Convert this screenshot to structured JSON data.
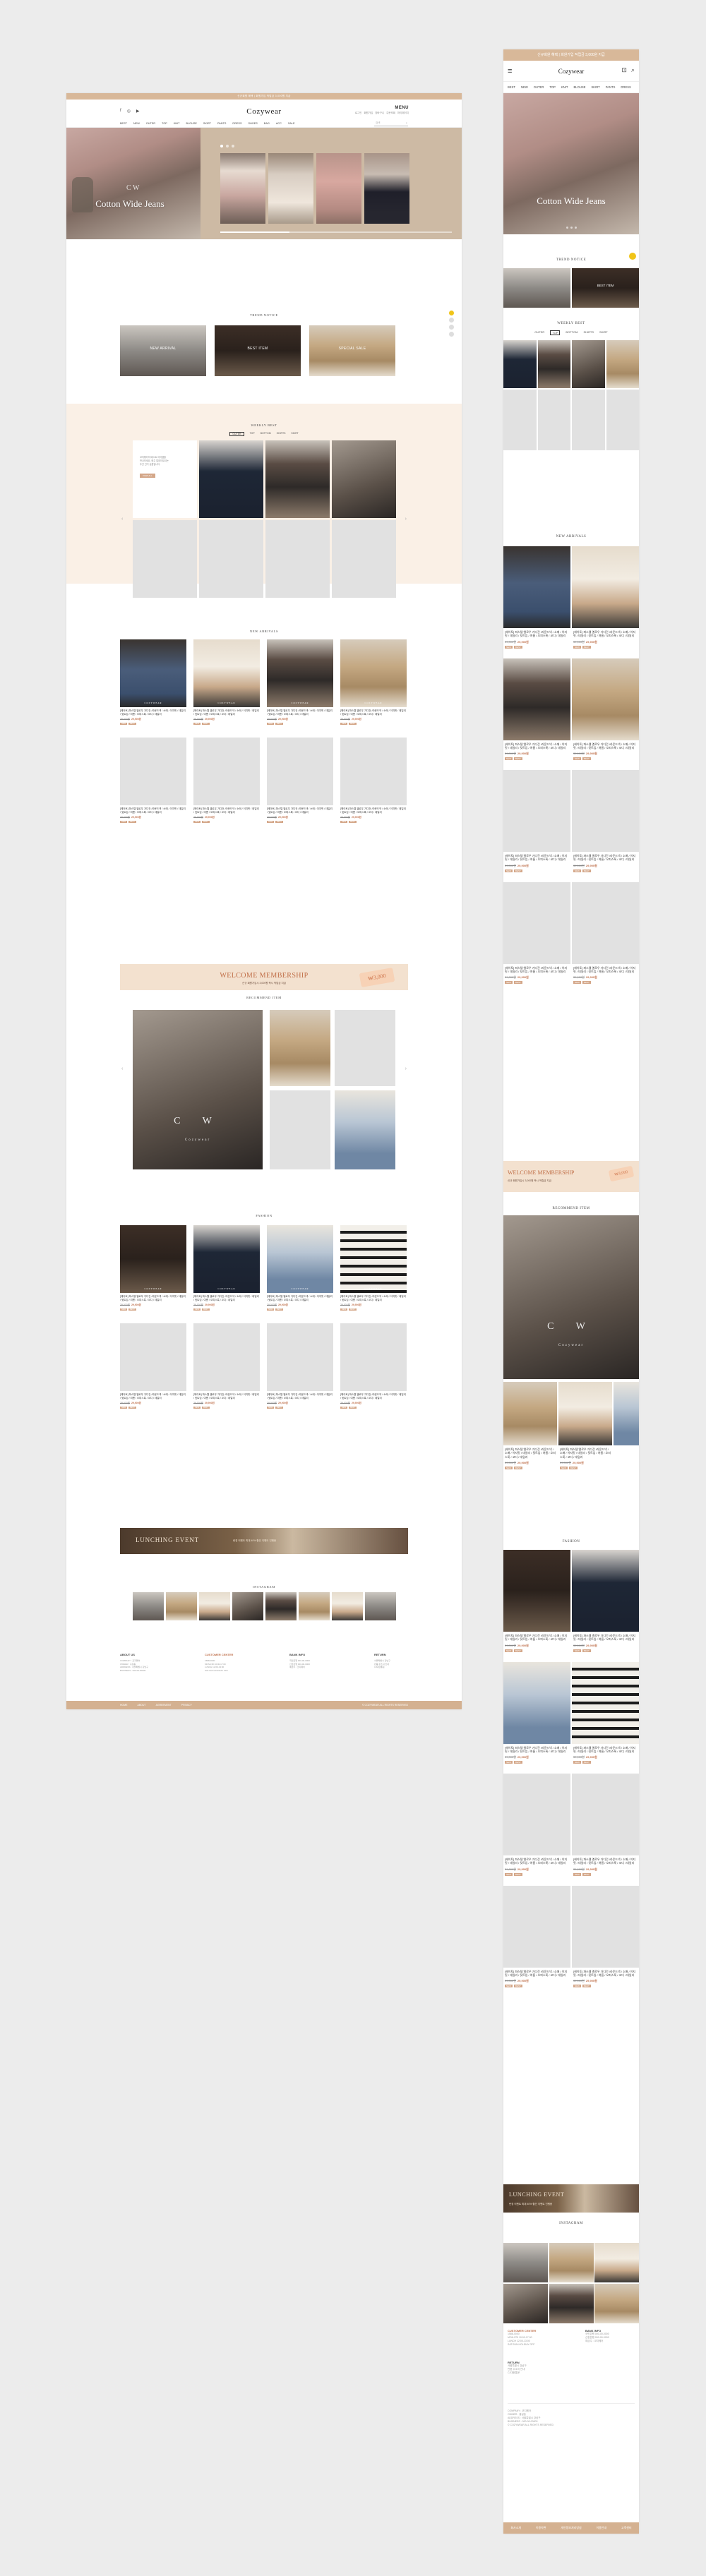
{
  "brand": {
    "logo": "Cozywear",
    "accent": "#d8b899",
    "price_color": "#c0734f"
  },
  "topbar": {
    "text": "신규회원 혜택 | 회원가입 적립금 3,000원 지급"
  },
  "header": {
    "social": [
      "f",
      "◎",
      "▶"
    ],
    "util_title": "MENU",
    "util_links": "로그인 회원가입 장바구니 주문조회 마이페이지",
    "nav": [
      "BEST",
      "NEW",
      "OUTER",
      "TOP",
      "KNIT",
      "BLOUSE",
      "SKIRT",
      "PANTS",
      "DRESS",
      "SHOES",
      "BAG",
      "ACC",
      "SALE"
    ],
    "search_placeholder": "검색",
    "search_icon": "search-icon"
  },
  "hero": {
    "title": "Cotton Wide Jeans",
    "monogram": "C W"
  },
  "trend": {
    "title": "TREND NOTICE",
    "items": [
      "NEW ARRIVAL",
      "BEST ITEM",
      "SPECIAL SALE"
    ]
  },
  "weekly": {
    "title": "WEEKLY BEST",
    "tabs": [
      "OUTER",
      "TOP",
      "BOTTOM",
      "SHIRTS",
      "SKIRT"
    ],
    "intro": [
      "코지웨어의 베스트 아이템을",
      "만나보세요. 매주 업데이트되는",
      "주간 인기 상품입니다."
    ],
    "intro_btn": "VIEW ALL"
  },
  "new_arrivals": {
    "title": "NEW ARRIVALS",
    "watermark": "COZYWEAR",
    "product_name": "[헤이토] 파스텔 옐로우 가디건 /라운드넥 / 소매 / 이지핏 / 데일리 / 뒷트임 / 여름 / 오피스룩 / 코디 / 데일리",
    "price": "39,000원",
    "sale": "29,900원",
    "tags": [
      "NEW",
      "BEST"
    ]
  },
  "membership": {
    "title": "WELCOME MEMBERSHIP",
    "sub": "신규 회원가입시 3,000원 즉시 적립금 지급",
    "coupon": "₩3,000"
  },
  "recommend": {
    "title": "RECOMMEND ITEM",
    "monogram": "C W",
    "wordmark": "Cozywear"
  },
  "fashion": {
    "title": "FASHION"
  },
  "launch": {
    "title": "LUNCHING EVENT",
    "sub": "런칭 이벤트 최대 40% 할인 이벤트 진행중"
  },
  "instagram": {
    "title": "INSTAGRAM"
  },
  "footer": {
    "cols": [
      {
        "title": "ABOUT US",
        "lines": [
          "COMPANY : 코지웨어",
          "OWNER : 홍길동",
          "ADDRESS : 서울특별시 강남구",
          "BUSINESS : 000-00-00000"
        ]
      },
      {
        "title": "CUSTOMER CENTER",
        "lines": [
          "1588-0000",
          "MON-FRI 10:00-17:00",
          "LUNCH 12:00-13:00",
          "SAT.SUN.HOLIDAY OFF"
        ]
      },
      {
        "title": "BANK INFO",
        "lines": [
          "국민은행 000-00-0000",
          "신한은행 000-00-0000",
          "예금주 : 코지웨어"
        ]
      },
      {
        "title": "RETURN",
        "lines": [
          "서울특별시 강남구",
          "반품 주소지 안내",
          "CJ대한통운"
        ]
      }
    ],
    "links": [
      "HOME",
      "ABOUT",
      "AGREEMENT",
      "PRIVACY"
    ],
    "copyright": "© COZYWEAR ALL RIGHTS RESERVED",
    "mobile_links": [
      "회사소개",
      "이용약관",
      "개인정보처리방침",
      "이용안내",
      "고객센터"
    ]
  },
  "mobile": {
    "top_text": "신규회원 혜택 | 회원가입 적립금 3,000원 지급",
    "nav": [
      "BEST",
      "NEW",
      "OUTER",
      "TOP",
      "KNIT",
      "BLOUSE",
      "SKIRT",
      "PANTS",
      "DRESS"
    ]
  }
}
